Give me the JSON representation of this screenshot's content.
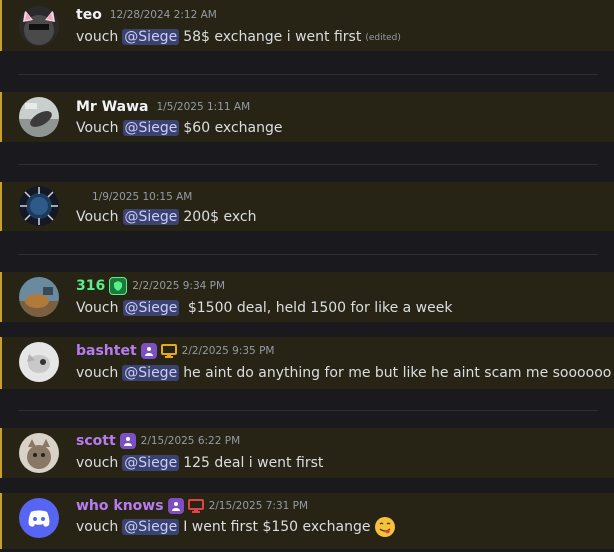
{
  "messages": [
    {
      "username": "teo",
      "name_color": "#f2f3f5",
      "timestamp": "12/28/2024 2:12 AM",
      "prefix": "vouch",
      "mention": "@Siege",
      "content": "58$ exchange i went first",
      "edited": "(edited)",
      "avatar": "cat-ears-avatar"
    },
    {
      "username": "Mr Wawa",
      "name_color": "#f2f3f5",
      "timestamp": "1/5/2025 1:11 AM",
      "prefix": "Vouch",
      "mention": "@Siege",
      "content": "$60 exchange",
      "avatar": "photo-avatar"
    },
    {
      "username": "",
      "name_color": "#f2f3f5",
      "timestamp": "1/9/2025 10:15 AM",
      "prefix": "Vouch",
      "mention": "@Siege",
      "content": "200$ exch",
      "avatar": "spiked-orb-avatar"
    },
    {
      "username": "316",
      "name_color": "#57f287",
      "timestamp": "2/2/2025 9:34 PM",
      "prefix": "Vouch",
      "mention": "@Siege",
      "content": " $1500 deal, held 1500 for like a week",
      "avatar": "photo-avatar",
      "badges": [
        "green-shield-icon"
      ]
    },
    {
      "username": "bashtet",
      "name_color": "#b77cf2",
      "timestamp": "2/2/2025 9:35 PM",
      "prefix": "vouch",
      "mention": "@Siege",
      "content": "he aint do anything for me but like he aint scam me soooooo",
      "avatar": "photo-avatar",
      "badges": [
        "purple-person-icon",
        "yellow-monitor-icon"
      ]
    },
    {
      "username": "scott",
      "name_color": "#b77cf2",
      "timestamp": "2/15/2025 6:22 PM",
      "prefix": "vouch",
      "mention": "@Siege",
      "content": "125 deal i went first",
      "avatar": "cat-photo-avatar",
      "badges": [
        "purple-person-icon"
      ]
    },
    {
      "username": "who knows",
      "name_color": "#b77cf2",
      "timestamp": "2/15/2025 7:31 PM",
      "prefix": "vouch",
      "mention": "@Siege",
      "content": "I went first $150 exchange",
      "avatar": "discord-default-avatar",
      "badges": [
        "purple-person-icon",
        "red-monitor-icon"
      ],
      "emoji": "yum-face-emoji"
    }
  ]
}
